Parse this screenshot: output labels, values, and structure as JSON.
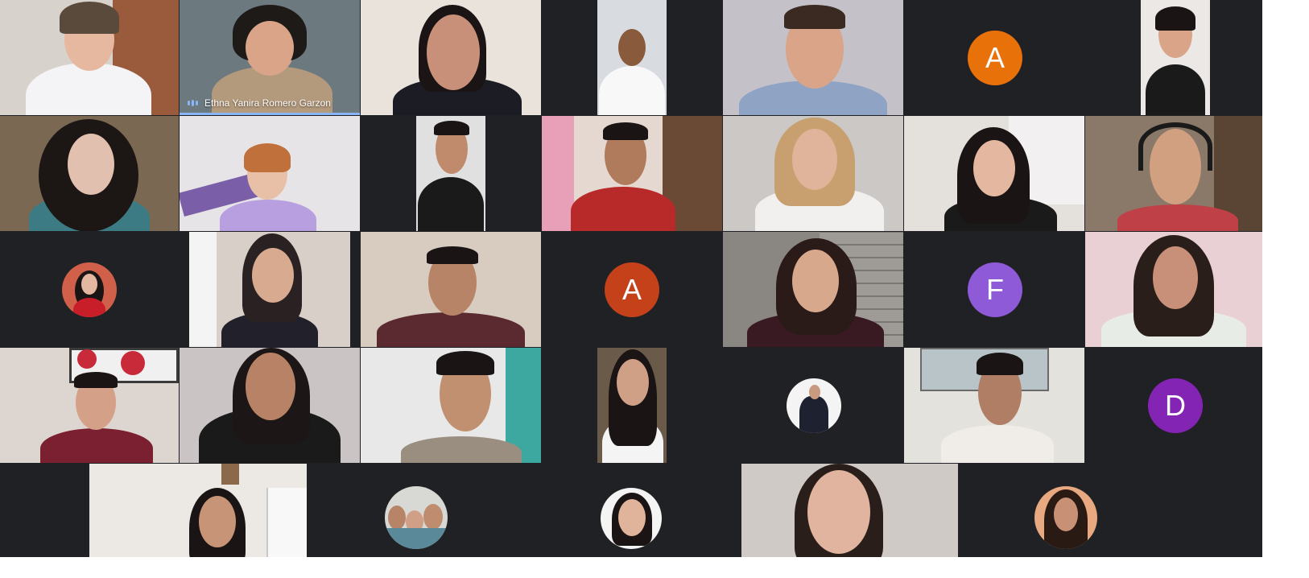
{
  "meeting": {
    "active_speaker_name": "Ethna Yanira Romero Garzon",
    "avatar_letters": {
      "r1_c6": "A",
      "r3_c4": "A",
      "r3_c6": "F",
      "r4_c7": "D"
    }
  },
  "colors": {
    "background": "#202124",
    "avatar_orange": "#e8710a",
    "avatar_redorange": "#c5411a",
    "avatar_purple": "#8e5ad8",
    "avatar_violet": "#8424b5",
    "speaking_accent": "#8ab4f8"
  }
}
